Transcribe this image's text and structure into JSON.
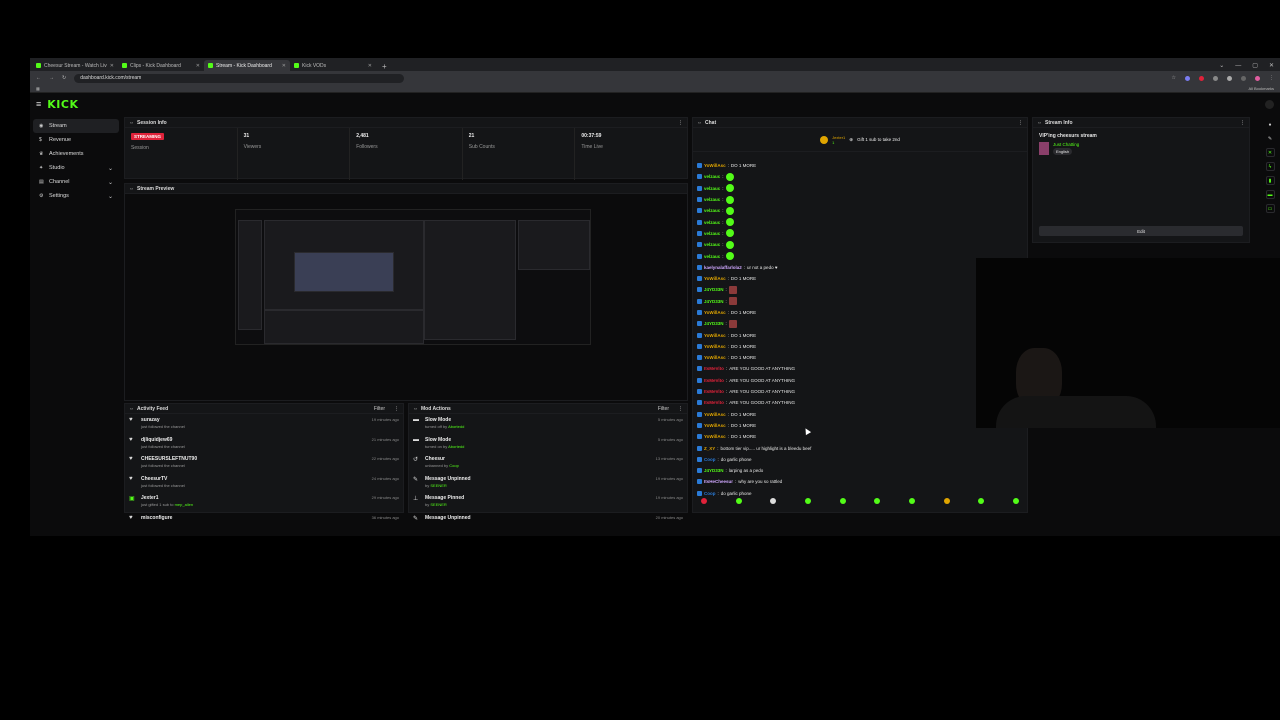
{
  "browser": {
    "tabs": [
      {
        "title": "Cheesur Stream - Watch Live o"
      },
      {
        "title": "Clips - Kick Dashboard"
      },
      {
        "title": "Stream - Kick Dashboard",
        "active": true
      },
      {
        "title": "Kick VODs"
      }
    ],
    "url": "dashboard.kick.com/stream",
    "bookmarks_label": "All Bookmarks"
  },
  "app": {
    "logo": "KICK",
    "sidebar": [
      {
        "label": "Stream",
        "icon": "broadcast-icon",
        "active": true
      },
      {
        "label": "Revenue",
        "icon": "dollar-icon"
      },
      {
        "label": "Achievements",
        "icon": "trophy-icon"
      },
      {
        "label": "Studio",
        "icon": "studio-icon",
        "expandable": true
      },
      {
        "label": "Channel",
        "icon": "channel-icon",
        "expandable": true
      },
      {
        "label": "Settings",
        "icon": "gear-icon",
        "expandable": true
      }
    ]
  },
  "session_info": {
    "title": "Session Info",
    "status": "STREAMING",
    "status_label": "Session",
    "viewers": {
      "value": "31",
      "label": "Viewers"
    },
    "followers": {
      "value": "2,481",
      "label": "Followers"
    },
    "subs": {
      "value": "21",
      "label": "Sub Counts"
    },
    "time_live": {
      "value": "00:37:59",
      "label": "Time Live"
    }
  },
  "stream_preview": {
    "title": "Stream Preview"
  },
  "activity_feed": {
    "title": "Activity Feed",
    "filter": "Filter",
    "items": [
      {
        "name": "surazay",
        "sub": "just followed the channel",
        "time": "19 minutes ago"
      },
      {
        "name": "djliquidjew69",
        "sub": "just followed the channel",
        "time": "21 minutes ago"
      },
      {
        "name": "CHEESURSLEFTNUT90",
        "sub": "just followed the channel",
        "time": "22 minutes ago"
      },
      {
        "name": "CheesurTV",
        "sub": "just followed the channel",
        "time": "24 minutes ago"
      },
      {
        "name": "Jexter1",
        "sub": "just gifted 1 sub to",
        "highlight": "mep_allen",
        "time": "29 minutes ago"
      },
      {
        "name": "misconfigure",
        "sub": "",
        "time": "36 minutes ago"
      }
    ]
  },
  "mod_actions": {
    "title": "Mod Actions",
    "filter": "Filter",
    "items": [
      {
        "name": "Slow Mode",
        "sub": "turned off by",
        "by": "Abortedd",
        "time": "5 minutes ago"
      },
      {
        "name": "Slow Mode",
        "sub": "turned on by",
        "by": "Abortedd",
        "time": "5 minutes ago"
      },
      {
        "name": "Cheesur",
        "sub": "unbanned by",
        "by": "Coop",
        "time": "13 minutes ago"
      },
      {
        "name": "Message Unpinned",
        "sub": "by",
        "by": "SEENER",
        "time": "19 minutes ago"
      },
      {
        "name": "Message Pinned",
        "sub": "by",
        "by": "SEENER",
        "time": "19 minutes ago"
      },
      {
        "name": "Message Unpinned",
        "sub": "",
        "by": "",
        "time": "20 minutes ago"
      }
    ]
  },
  "chat": {
    "title": "Chat",
    "pinned": {
      "user": "Jexter1",
      "count": "1",
      "text": "Gift 1 sub to take 2nd"
    },
    "messages": [
      {
        "user": "YoWillAsc",
        "color": "#e0a500",
        "text": "DO 1 MORE"
      },
      {
        "user": "velzauc",
        "color": "#53fc18",
        "text": "",
        "emote": true
      },
      {
        "user": "velzauc",
        "color": "#53fc18",
        "text": "",
        "emote": true
      },
      {
        "user": "velzauc",
        "color": "#53fc18",
        "text": "",
        "emote": true
      },
      {
        "user": "velzauc",
        "color": "#53fc18",
        "text": "",
        "emote": true
      },
      {
        "user": "velzauc",
        "color": "#53fc18",
        "text": "",
        "emote": true
      },
      {
        "user": "velzauc",
        "color": "#53fc18",
        "text": "",
        "emote": true
      },
      {
        "user": "velzauc",
        "color": "#53fc18",
        "text": "",
        "emote": true
      },
      {
        "user": "velzauc",
        "color": "#53fc18",
        "text": "",
        "emote": true
      },
      {
        "user": "kaelynalaffarlola2",
        "color": "#cfa8ff",
        "text": "ur not a pedo ♥"
      },
      {
        "user": "YoWillAsc",
        "color": "#e0a500",
        "text": "DO 1 MORE"
      },
      {
        "user": "J4YD33N",
        "color": "#53fc18",
        "text": "",
        "emote_pic": true
      },
      {
        "user": "J4YD33N",
        "color": "#53fc18",
        "text": "",
        "emote_pic": true
      },
      {
        "user": "YoWillAsc",
        "color": "#e0a500",
        "text": "DO 1 MORE"
      },
      {
        "user": "J4YD33N",
        "color": "#53fc18",
        "text": "",
        "emote_pic": true
      },
      {
        "user": "YoWillAsc",
        "color": "#e0a500",
        "text": "DO 1 MORE"
      },
      {
        "user": "YoWillAsc",
        "color": "#e0a500",
        "text": "DO 1 MORE"
      },
      {
        "user": "YoWillAsc",
        "color": "#e0a500",
        "text": "DO 1 MORE"
      },
      {
        "user": "ItsMeVito",
        "color": "#e0223a",
        "text": "ARE YOU GOOD AT ANYTHING"
      },
      {
        "user": "ItsMeVito",
        "color": "#e0223a",
        "text": "ARE YOU GOOD AT ANYTHING"
      },
      {
        "user": "ItsMeVito",
        "color": "#e0223a",
        "text": "ARE YOU GOOD AT ANYTHING"
      },
      {
        "user": "ItsMeVito",
        "color": "#e0223a",
        "text": "ARE YOU GOOD AT ANYTHING"
      },
      {
        "user": "YoWillAsc",
        "color": "#e0a500",
        "text": "DO 1 MORE"
      },
      {
        "user": "YoWillAsc",
        "color": "#e0a500",
        "text": "DO 1 MORE"
      },
      {
        "user": "YoWillAsc",
        "color": "#e0a500",
        "text": "DO 1 MORE"
      },
      {
        "user": "Z_XY",
        "color": "#e0a500",
        "text": "bottom tier vip..... ur highlight is a bleedu beef"
      },
      {
        "user": "Coop",
        "color": "#2a7bd8",
        "text": "do garlic phone"
      },
      {
        "user": "J4YD33N",
        "color": "#53fc18",
        "text": "larping as a pedo"
      },
      {
        "user": "ItsHeCheesur",
        "color": "#cfa8ff",
        "text": "why are you so rattled"
      },
      {
        "user": "Coop",
        "color": "#2a7bd8",
        "text": "do garlic phone"
      },
      {
        "user": "ItsMeVito",
        "color": "#e0223a",
        "text": "ARE YOU GOOD AT ANYTHING"
      }
    ]
  },
  "stream_info": {
    "title": "Stream Info",
    "stream_title": "VIP'ing cheesurs stream",
    "category": "Just Chatting",
    "language": "English",
    "edit_label": "Edit"
  }
}
